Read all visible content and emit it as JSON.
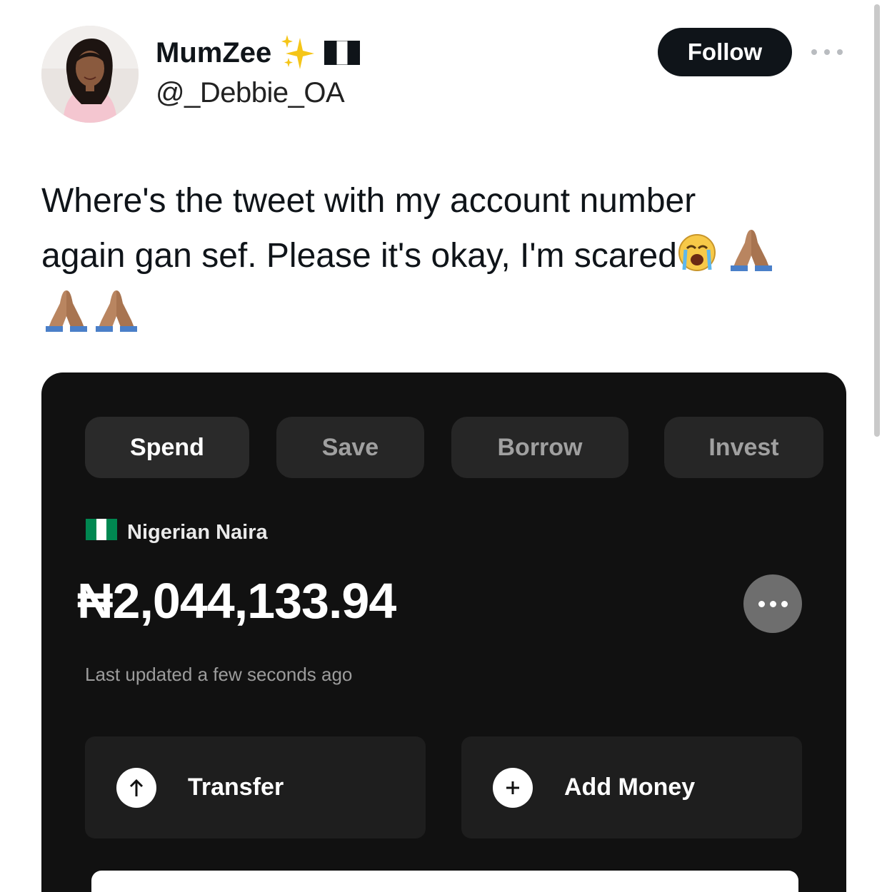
{
  "tweet": {
    "display_name": "MumZee",
    "handle": "@_Debbie_OA",
    "follow_label": "Follow",
    "text_line1": "Where's the tweet with my account number",
    "text_line2": "again gan sef. Please it's okay, I'm scared"
  },
  "wallet": {
    "tabs": [
      {
        "label": "Spend",
        "active": true
      },
      {
        "label": "Save",
        "active": false
      },
      {
        "label": "Borrow",
        "active": false
      },
      {
        "label": "Invest",
        "active": false
      }
    ],
    "currency_label": "Nigerian Naira",
    "balance": "₦2,044,133.94",
    "last_updated": "Last updated a few seconds ago",
    "actions": {
      "transfer_label": "Transfer",
      "add_money_label": "Add Money"
    }
  },
  "icons": {
    "sparkle": "sparkles-icon",
    "flag": "nigeria-flag-icon",
    "cry": "loudly-crying-face-icon",
    "pray": "folded-hands-icon"
  },
  "colors": {
    "follow_bg": "#0f1419",
    "card_bg": "#111111",
    "flag_green": "#008751"
  }
}
